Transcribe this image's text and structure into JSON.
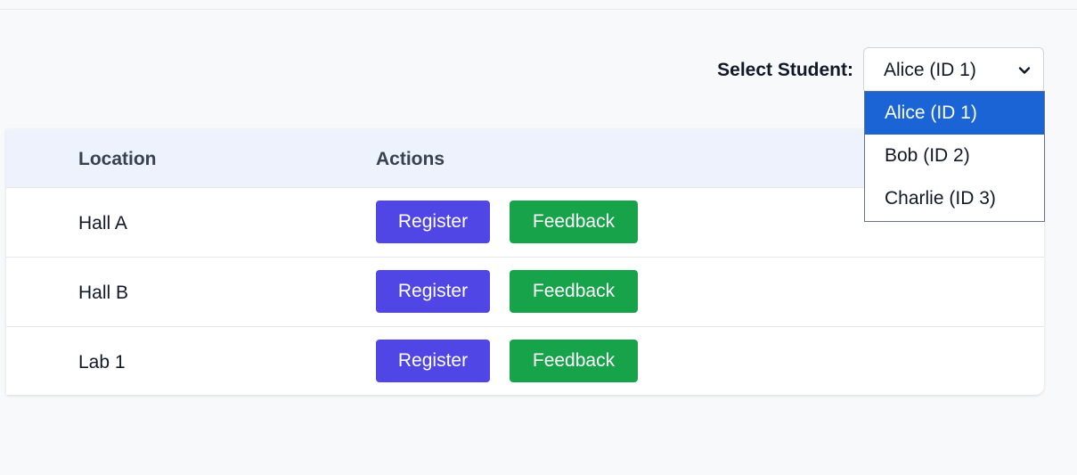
{
  "student_selector": {
    "label": "Select Student:",
    "selected_value": "Alice (ID 1)",
    "options": [
      {
        "label": "Alice (ID 1)",
        "selected": true
      },
      {
        "label": "Bob (ID 2)",
        "selected": false
      },
      {
        "label": "Charlie (ID 3)",
        "selected": false
      }
    ]
  },
  "table": {
    "columns": [
      "Location",
      "Actions"
    ],
    "rows": [
      {
        "location": "Hall A",
        "register_label": "Register",
        "feedback_label": "Feedback"
      },
      {
        "location": "Hall B",
        "register_label": "Register",
        "feedback_label": "Feedback"
      },
      {
        "location": "Lab 1",
        "register_label": "Register",
        "feedback_label": "Feedback"
      }
    ]
  },
  "icons": {
    "select_arrow": "chevron-down-icon"
  },
  "colors": {
    "register_button": "#4f46e5",
    "feedback_button": "#16a34a",
    "dropdown_highlight": "#1a64d6",
    "table_header_bg": "#eef2fd"
  }
}
